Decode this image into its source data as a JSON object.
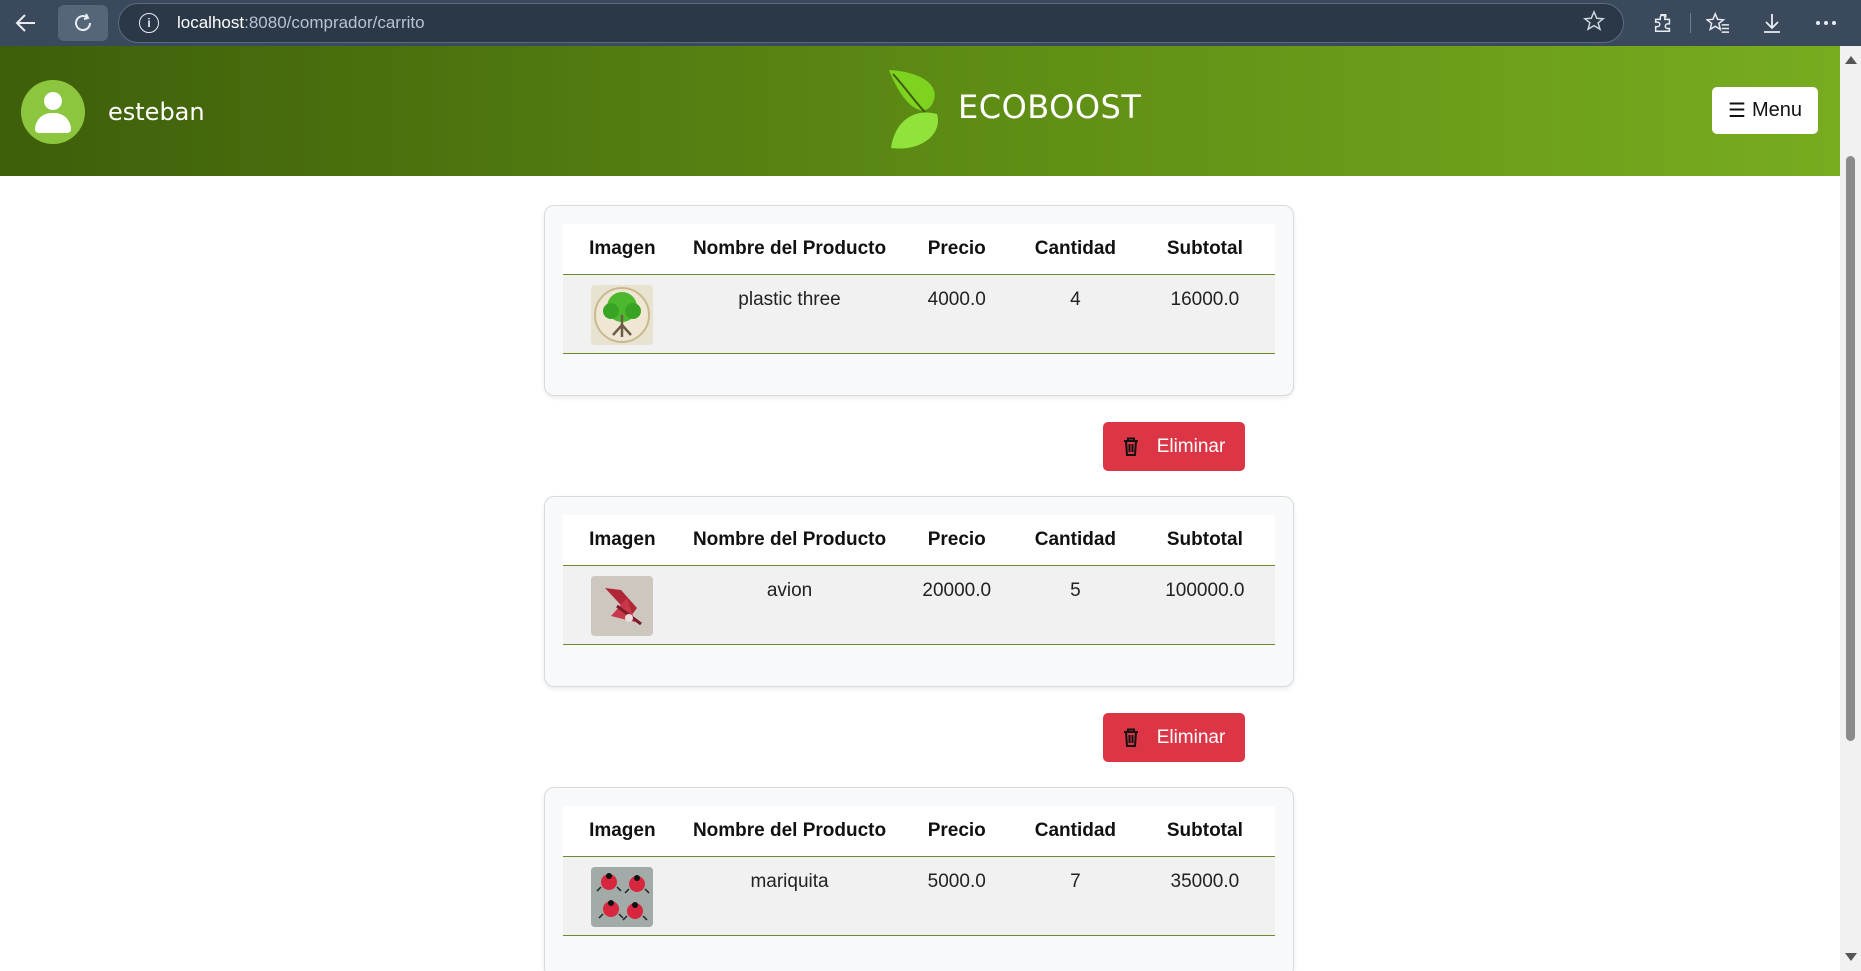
{
  "browser": {
    "url_host": "localhost",
    "url_path": ":8080/comprador/carrito"
  },
  "header": {
    "username": "esteban",
    "brand": "ECOBOOST",
    "menu_label": "Menu",
    "colors": {
      "gradient_start": "#3e5e0a",
      "gradient_end": "#78ac1f",
      "accent": "#8cc63f"
    }
  },
  "cart": {
    "columns": [
      "Imagen",
      "Nombre del Producto",
      "Precio",
      "Cantidad",
      "Subtotal"
    ],
    "delete_label": "Eliminar",
    "items": [
      {
        "image": "tree-product-image",
        "name": "plastic three",
        "price": "4000.0",
        "quantity": "4",
        "subtotal": "16000.0"
      },
      {
        "image": "airplane-product-image",
        "name": "avion",
        "price": "20000.0",
        "quantity": "5",
        "subtotal": "100000.0"
      },
      {
        "image": "ladybug-product-image",
        "name": "mariquita",
        "price": "5000.0",
        "quantity": "7",
        "subtotal": "35000.0"
      }
    ]
  },
  "colors": {
    "delete_button": "#dc3545"
  }
}
